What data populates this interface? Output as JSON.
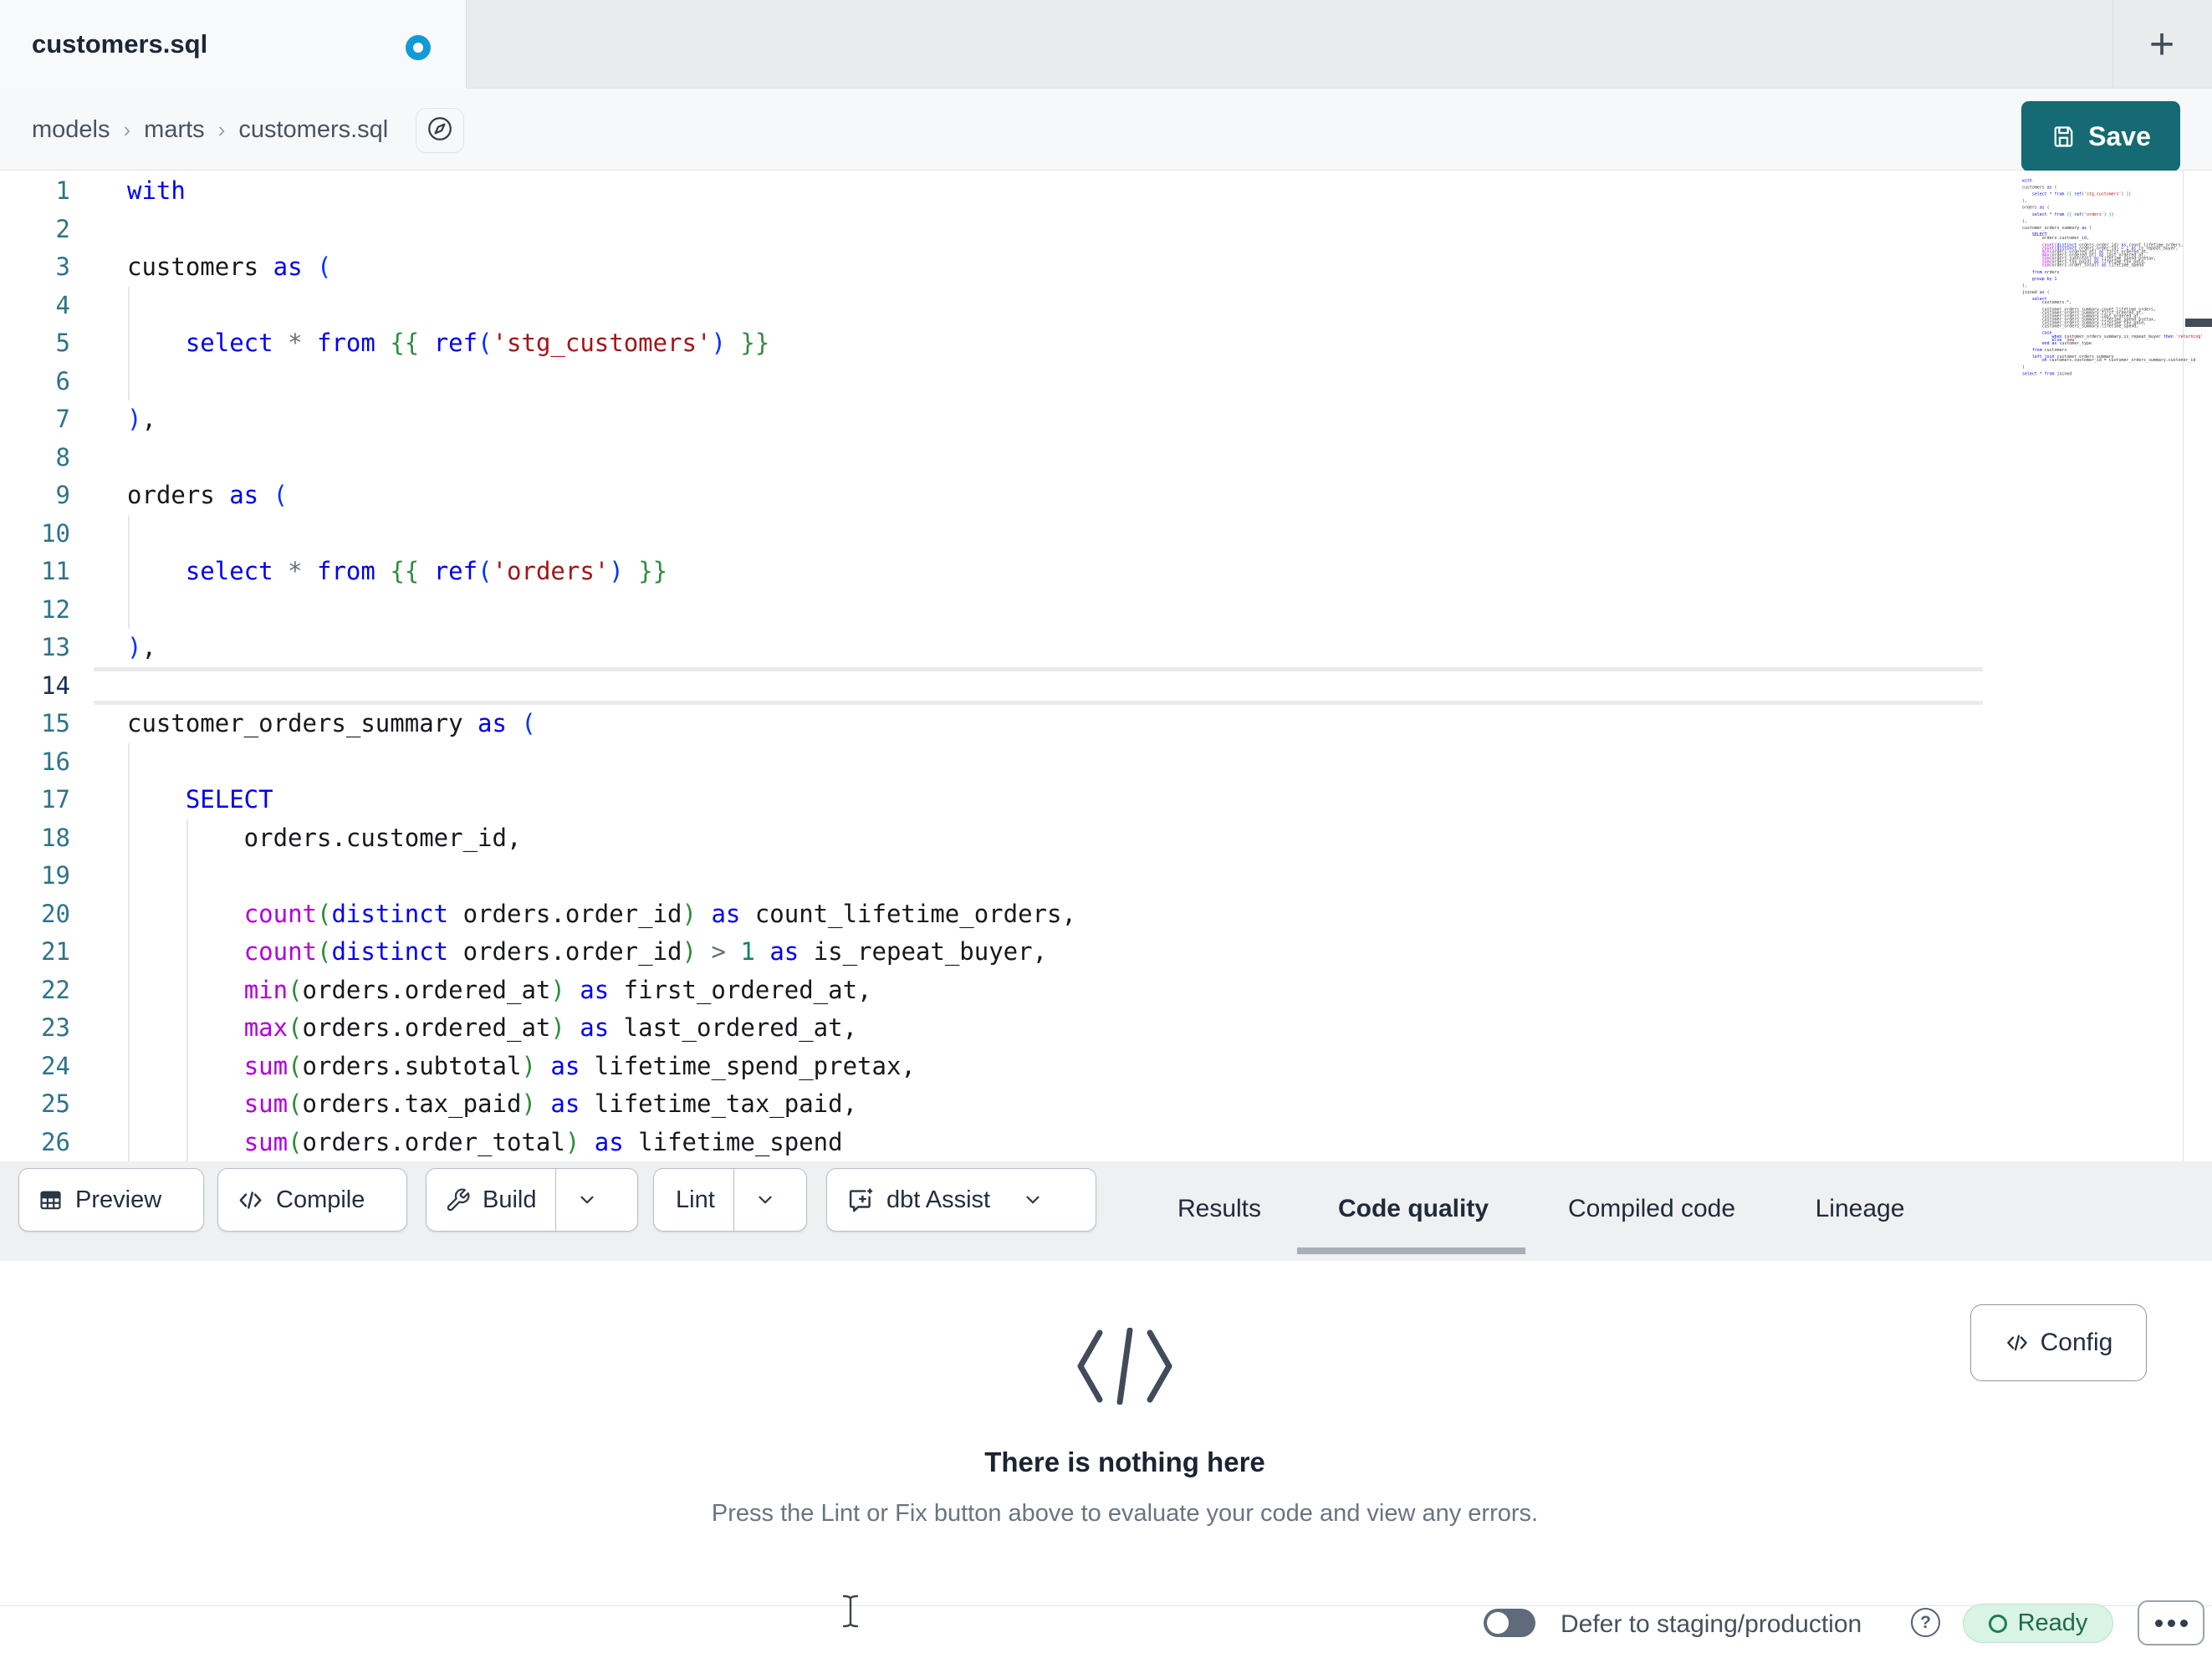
{
  "theme": {
    "save_bg": "#156a74",
    "unsaved_dot": "#0f9bd7",
    "tab_underline": "#a9afb8",
    "ready_bg": "#d9f3e5",
    "ready_border": "#b9e6cd",
    "ready_ring": "#1e7d56",
    "ready_text": "#1d6b4c"
  },
  "tab_bar": {
    "title": "customers.sql",
    "new_tab_icon": "+"
  },
  "breadcrumb": {
    "items": [
      "models",
      "marts",
      "customers.sql"
    ],
    "separator": "›"
  },
  "save_button": {
    "label": "Save"
  },
  "editor": {
    "active_line": 14,
    "colors": {
      "k": "#0000f0",
      "f": "#af00db",
      "s": "#a31515",
      "j": "#2f8b3d",
      "b": "#0431fa",
      "g": "#2e8b3a",
      "n": "#098658",
      "o": "#687078",
      "p": "#16181d",
      "ln": "#2f7389",
      "ln_active": "#1c2f54"
    },
    "indent_guides": [
      {
        "col": 0,
        "from": 4,
        "to": 6
      },
      {
        "col": 0,
        "from": 10,
        "to": 12
      },
      {
        "col": 0,
        "from": 16,
        "to": 26
      },
      {
        "col": 4,
        "from": 18,
        "to": 26
      }
    ],
    "lines": [
      [
        [
          "k",
          "with"
        ]
      ],
      [],
      [
        [
          "p",
          "customers "
        ],
        [
          "k",
          "as"
        ],
        [
          "p",
          " "
        ],
        [
          "b",
          "("
        ]
      ],
      [],
      [
        [
          "p",
          "    "
        ],
        [
          "k",
          "select"
        ],
        [
          "p",
          " "
        ],
        [
          "o",
          "*"
        ],
        [
          "p",
          " "
        ],
        [
          "k",
          "from"
        ],
        [
          "p",
          " "
        ],
        [
          "j",
          "{{"
        ],
        [
          "p",
          " "
        ],
        [
          "k",
          "ref"
        ],
        [
          "b",
          "("
        ],
        [
          "s",
          "'stg_customers'"
        ],
        [
          "b",
          ")"
        ],
        [
          "p",
          " "
        ],
        [
          "j",
          "}}"
        ]
      ],
      [],
      [
        [
          "b",
          ")"
        ],
        [
          "p",
          ","
        ]
      ],
      [],
      [
        [
          "p",
          "orders "
        ],
        [
          "k",
          "as"
        ],
        [
          "p",
          " "
        ],
        [
          "b",
          "("
        ]
      ],
      [],
      [
        [
          "p",
          "    "
        ],
        [
          "k",
          "select"
        ],
        [
          "p",
          " "
        ],
        [
          "o",
          "*"
        ],
        [
          "p",
          " "
        ],
        [
          "k",
          "from"
        ],
        [
          "p",
          " "
        ],
        [
          "j",
          "{{"
        ],
        [
          "p",
          " "
        ],
        [
          "k",
          "ref"
        ],
        [
          "b",
          "("
        ],
        [
          "s",
          "'orders'"
        ],
        [
          "b",
          ")"
        ],
        [
          "p",
          " "
        ],
        [
          "j",
          "}}"
        ]
      ],
      [],
      [
        [
          "b",
          ")"
        ],
        [
          "p",
          ","
        ]
      ],
      [],
      [
        [
          "p",
          "customer_orders_summary "
        ],
        [
          "k",
          "as"
        ],
        [
          "p",
          " "
        ],
        [
          "b",
          "("
        ]
      ],
      [],
      [
        [
          "p",
          "    "
        ],
        [
          "k",
          "SELECT"
        ]
      ],
      [
        [
          "p",
          "        orders.customer_id,"
        ]
      ],
      [],
      [
        [
          "p",
          "        "
        ],
        [
          "f",
          "count"
        ],
        [
          "g",
          "("
        ],
        [
          "k",
          "distinct"
        ],
        [
          "p",
          " orders.order_id"
        ],
        [
          "g",
          ")"
        ],
        [
          "p",
          " "
        ],
        [
          "k",
          "as"
        ],
        [
          "p",
          " count_lifetime_orders,"
        ]
      ],
      [
        [
          "p",
          "        "
        ],
        [
          "f",
          "count"
        ],
        [
          "g",
          "("
        ],
        [
          "k",
          "distinct"
        ],
        [
          "p",
          " orders.order_id"
        ],
        [
          "g",
          ")"
        ],
        [
          "p",
          " "
        ],
        [
          "o",
          ">"
        ],
        [
          "p",
          " "
        ],
        [
          "n",
          "1"
        ],
        [
          "p",
          " "
        ],
        [
          "k",
          "as"
        ],
        [
          "p",
          " is_repeat_buyer,"
        ]
      ],
      [
        [
          "p",
          "        "
        ],
        [
          "f",
          "min"
        ],
        [
          "g",
          "("
        ],
        [
          "p",
          "orders.ordered_at"
        ],
        [
          "g",
          ")"
        ],
        [
          "p",
          " "
        ],
        [
          "k",
          "as"
        ],
        [
          "p",
          " first_ordered_at,"
        ]
      ],
      [
        [
          "p",
          "        "
        ],
        [
          "f",
          "max"
        ],
        [
          "g",
          "("
        ],
        [
          "p",
          "orders.ordered_at"
        ],
        [
          "g",
          ")"
        ],
        [
          "p",
          " "
        ],
        [
          "k",
          "as"
        ],
        [
          "p",
          " last_ordered_at,"
        ]
      ],
      [
        [
          "p",
          "        "
        ],
        [
          "f",
          "sum"
        ],
        [
          "g",
          "("
        ],
        [
          "p",
          "orders.subtotal"
        ],
        [
          "g",
          ")"
        ],
        [
          "p",
          " "
        ],
        [
          "k",
          "as"
        ],
        [
          "p",
          " lifetime_spend_pretax,"
        ]
      ],
      [
        [
          "p",
          "        "
        ],
        [
          "f",
          "sum"
        ],
        [
          "g",
          "("
        ],
        [
          "p",
          "orders.tax_paid"
        ],
        [
          "g",
          ")"
        ],
        [
          "p",
          " "
        ],
        [
          "k",
          "as"
        ],
        [
          "p",
          " lifetime_tax_paid,"
        ]
      ],
      [
        [
          "p",
          "        "
        ],
        [
          "f",
          "sum"
        ],
        [
          "g",
          "("
        ],
        [
          "p",
          "orders.order_total"
        ],
        [
          "g",
          ")"
        ],
        [
          "p",
          " "
        ],
        [
          "k",
          "as"
        ],
        [
          "p",
          " lifetime_spend"
        ]
      ]
    ]
  },
  "minimap": {
    "lines": [
      "with",
      "",
      "customers as (",
      "",
      "    select * from {{ ref('stg_customers') }}",
      "",
      "),",
      "",
      "orders as (",
      "",
      "    select * from {{ ref('orders') }}",
      "",
      "),",
      "",
      "customer_orders_summary as (",
      "",
      "    SELECT",
      "        orders.customer_id,",
      "",
      "        count(distinct orders.order_id) as count_lifetime_orders,",
      "        count(distinct orders.order_id) > 1 as is_repeat_buyer,",
      "        min(orders.ordered_at) as first_ordered_at,",
      "        max(orders.ordered_at) as last_ordered_at,",
      "        sum(orders.subtotal) as lifetime_spend_pretax,",
      "        sum(orders.tax_paid) as lifetime_tax_paid,",
      "        sum(orders.order_total) as lifetime_spend",
      "",
      "    from orders",
      "",
      "    group by 1",
      "",
      "),",
      "",
      "joined as (",
      "",
      "    select",
      "        customers.*,",
      "",
      "        customer_orders_summary.count_lifetime_orders,",
      "        customer_orders_summary.first_ordered_at,",
      "        customer_orders_summary.last_ordered_at,",
      "        customer_orders_summary.lifetime_spend_pretax,",
      "        customer_orders_summary.lifetime_tax_paid,",
      "        customer_orders_summary.lifetime_spend,",
      "",
      "        case",
      "            when customer_orders_summary.is_repeat_buyer then 'returning'",
      "            else 'new'",
      "        end as customer_type",
      "",
      "    from customers",
      "",
      "    left join customer_orders_summary",
      "        on customers.customer_id = customer_orders_summary.customer_id",
      "",
      ")",
      "",
      "select * from joined"
    ]
  },
  "toolbar": {
    "preview_label": "Preview",
    "compile_label": "Compile",
    "build_label": "Build",
    "lint_label": "Lint",
    "assist_label": "dbt Assist"
  },
  "result_tabs": {
    "items": [
      "Results",
      "Code quality",
      "Compiled code",
      "Lineage"
    ],
    "active": "Code quality"
  },
  "panel": {
    "title": "There is nothing here",
    "subtitle": "Press the Lint or Fix button above to evaluate your code and view any errors.",
    "config_label": "Config"
  },
  "status_bar": {
    "defer_label": "Defer to staging/production",
    "ready_label": "Ready",
    "toggle_on": false
  }
}
